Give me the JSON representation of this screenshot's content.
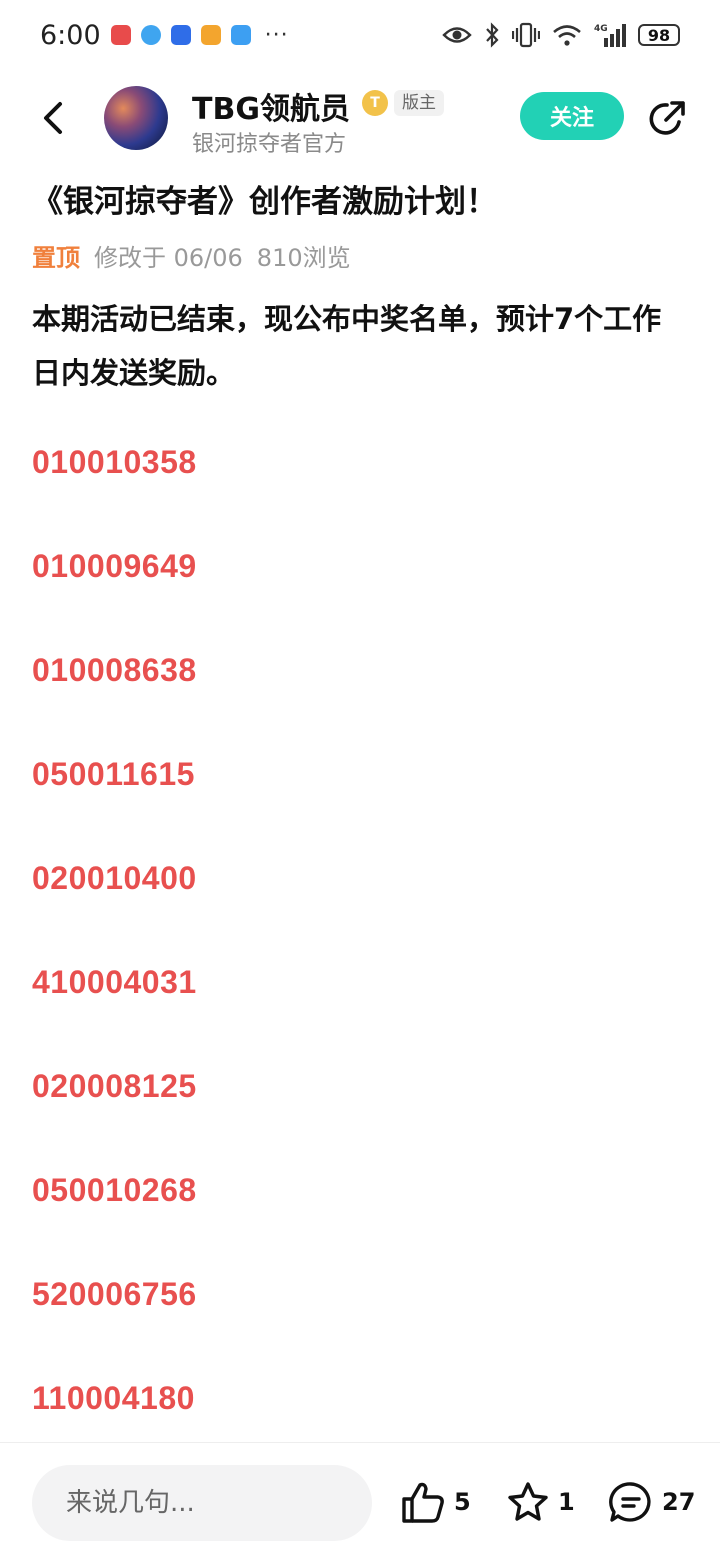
{
  "status_bar": {
    "time": "6:00",
    "battery": "98",
    "network": "4G",
    "more": "···",
    "icons": [
      "eye-icon",
      "bluetooth-icon",
      "vibrate-icon",
      "wifi-icon",
      "signal-icon"
    ]
  },
  "header": {
    "user_name": "TBG领航员",
    "coin_badge": "T",
    "role_badge": "版主",
    "subtitle": "银河掠夺者官方",
    "follow_label": "关注"
  },
  "post": {
    "title": "《银河掠夺者》创作者激励计划！",
    "pinned_label": "置顶",
    "modified": "修改于 06/06",
    "views": "810浏览",
    "intro": "本期活动已结束，现公布中奖名单，预计7个工作日内发送奖励。",
    "winners": [
      "010010358",
      "010009649",
      "010008638",
      "050011615",
      "020010400",
      "410004031",
      "020008125",
      "050010268",
      "520006756",
      "110004180"
    ]
  },
  "bottom_bar": {
    "comment_placeholder": "来说几句...",
    "like_count": "5",
    "favorite_count": "1",
    "comment_count": "27"
  },
  "colors": {
    "accent": "#22d1b5",
    "winner_red": "#e8504f",
    "pinned_orange": "#f0803c"
  }
}
